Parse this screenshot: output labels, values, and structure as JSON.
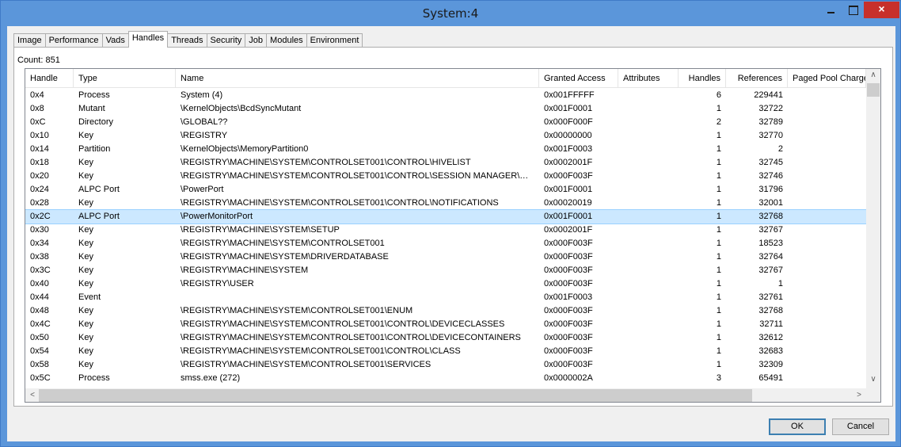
{
  "window": {
    "title": "System:4",
    "close_glyph": "×"
  },
  "tabs": [
    "Image",
    "Performance",
    "Vads",
    "Handles",
    "Threads",
    "Security",
    "Job",
    "Modules",
    "Environment"
  ],
  "active_tab": "Handles",
  "count_label": "Count: 851",
  "columns": [
    "Handle",
    "Type",
    "Name",
    "Granted Access",
    "Attributes",
    "Handles",
    "References",
    "Paged Pool Charge"
  ],
  "rows": [
    [
      "0x4",
      "Process",
      "System (4)",
      "0x001FFFFF",
      "",
      "6",
      "229441",
      ""
    ],
    [
      "0x8",
      "Mutant",
      "\\KernelObjects\\BcdSyncMutant",
      "0x001F0001",
      "",
      "1",
      "32722",
      ""
    ],
    [
      "0xC",
      "Directory",
      "\\GLOBAL??",
      "0x000F000F",
      "",
      "2",
      "32789",
      ""
    ],
    [
      "0x10",
      "Key",
      "\\REGISTRY",
      "0x00000000",
      "",
      "1",
      "32770",
      ""
    ],
    [
      "0x14",
      "Partition",
      "\\KernelObjects\\MemoryPartition0",
      "0x001F0003",
      "",
      "1",
      "2",
      ""
    ],
    [
      "0x18",
      "Key",
      "\\REGISTRY\\MACHINE\\SYSTEM\\CONTROLSET001\\CONTROL\\HIVELIST",
      "0x0002001F",
      "",
      "1",
      "32745",
      ""
    ],
    [
      "0x20",
      "Key",
      "\\REGISTRY\\MACHINE\\SYSTEM\\CONTROLSET001\\CONTROL\\SESSION MANAGER\\MEMORY...",
      "0x000F003F",
      "",
      "1",
      "32746",
      ""
    ],
    [
      "0x24",
      "ALPC Port",
      "\\PowerPort",
      "0x001F0001",
      "",
      "1",
      "31796",
      ""
    ],
    [
      "0x28",
      "Key",
      "\\REGISTRY\\MACHINE\\SYSTEM\\CONTROLSET001\\CONTROL\\NOTIFICATIONS",
      "0x00020019",
      "",
      "1",
      "32001",
      ""
    ],
    [
      "0x2C",
      "ALPC Port",
      "\\PowerMonitorPort",
      "0x001F0001",
      "",
      "1",
      "32768",
      ""
    ],
    [
      "0x30",
      "Key",
      "\\REGISTRY\\MACHINE\\SYSTEM\\SETUP",
      "0x0002001F",
      "",
      "1",
      "32767",
      ""
    ],
    [
      "0x34",
      "Key",
      "\\REGISTRY\\MACHINE\\SYSTEM\\CONTROLSET001",
      "0x000F003F",
      "",
      "1",
      "18523",
      ""
    ],
    [
      "0x38",
      "Key",
      "\\REGISTRY\\MACHINE\\SYSTEM\\DRIVERDATABASE",
      "0x000F003F",
      "",
      "1",
      "32764",
      ""
    ],
    [
      "0x3C",
      "Key",
      "\\REGISTRY\\MACHINE\\SYSTEM",
      "0x000F003F",
      "",
      "1",
      "32767",
      ""
    ],
    [
      "0x40",
      "Key",
      "\\REGISTRY\\USER",
      "0x000F003F",
      "",
      "1",
      "1",
      ""
    ],
    [
      "0x44",
      "Event",
      "",
      "0x001F0003",
      "",
      "1",
      "32761",
      ""
    ],
    [
      "0x48",
      "Key",
      "\\REGISTRY\\MACHINE\\SYSTEM\\CONTROLSET001\\ENUM",
      "0x000F003F",
      "",
      "1",
      "32768",
      ""
    ],
    [
      "0x4C",
      "Key",
      "\\REGISTRY\\MACHINE\\SYSTEM\\CONTROLSET001\\CONTROL\\DEVICECLASSES",
      "0x000F003F",
      "",
      "1",
      "32711",
      ""
    ],
    [
      "0x50",
      "Key",
      "\\REGISTRY\\MACHINE\\SYSTEM\\CONTROLSET001\\CONTROL\\DEVICECONTAINERS",
      "0x000F003F",
      "",
      "1",
      "32612",
      ""
    ],
    [
      "0x54",
      "Key",
      "\\REGISTRY\\MACHINE\\SYSTEM\\CONTROLSET001\\CONTROL\\CLASS",
      "0x000F003F",
      "",
      "1",
      "32683",
      ""
    ],
    [
      "0x58",
      "Key",
      "\\REGISTRY\\MACHINE\\SYSTEM\\CONTROLSET001\\SERVICES",
      "0x000F003F",
      "",
      "1",
      "32309",
      ""
    ],
    [
      "0x5C",
      "Process",
      "smss.exe (272)",
      "0x0000002A",
      "",
      "3",
      "65491",
      ""
    ]
  ],
  "selected_row": "0x2C",
  "buttons": {
    "ok": "OK",
    "cancel": "Cancel"
  },
  "scroll_glyphs": {
    "up": "∧",
    "down": "∨",
    "left": "<",
    "right": ">"
  }
}
